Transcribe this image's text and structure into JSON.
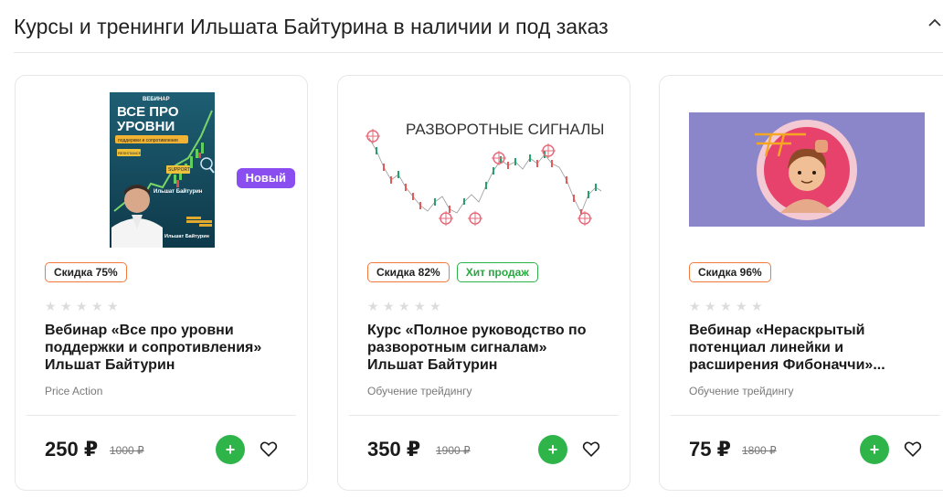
{
  "header": {
    "title": "Курсы и тренинги Ильшата Байтурина в наличии и под заказ"
  },
  "cards": [
    {
      "poster": {
        "label": "ВЕБИНАР",
        "heading_1": "ВСЕ ПРО",
        "heading_2": "УРОВНИ",
        "subheading": "поддержки и сопротивления",
        "chip_1": "RESISTANCE",
        "chip_2": "SUPPORT",
        "author": "Ильшат Байтурин",
        "author_bottom": "Ильшат Байтурин"
      },
      "badge_new": "Новый",
      "tags": [
        "Скидка 75%"
      ],
      "name": "Вебинар «Все про уровни поддержки и сопротивления» Ильшат Байтурин",
      "category": "Price Action",
      "price": "250 ₽",
      "old_price": "1000 ₽"
    },
    {
      "image_title": "РАЗВОРОТНЫЕ СИГНАЛЫ",
      "tags": [
        "Скидка 82%",
        "Хит продаж"
      ],
      "name": "Курс «Полное руководство по разворотным сигналам» Ильшат Байтурин",
      "category": "Обучение трейдингу",
      "price": "350 ₽",
      "old_price": "1900 ₽"
    },
    {
      "tags": [
        "Скидка 96%"
      ],
      "name": "Вебинар «Нераскрытый потенциал линейки и расширения Фибоначчи»...",
      "category": "Обучение трейдингу",
      "price": "75 ₽",
      "old_price": "1800 ₽"
    }
  ],
  "add_button_label": "+",
  "colors": {
    "accent_green": "#2fb44a",
    "badge_purple": "#8a4df0",
    "discount_border": "#f27a3a",
    "hit_green": "#2aa640",
    "fib_bg": "#8b86c9"
  }
}
